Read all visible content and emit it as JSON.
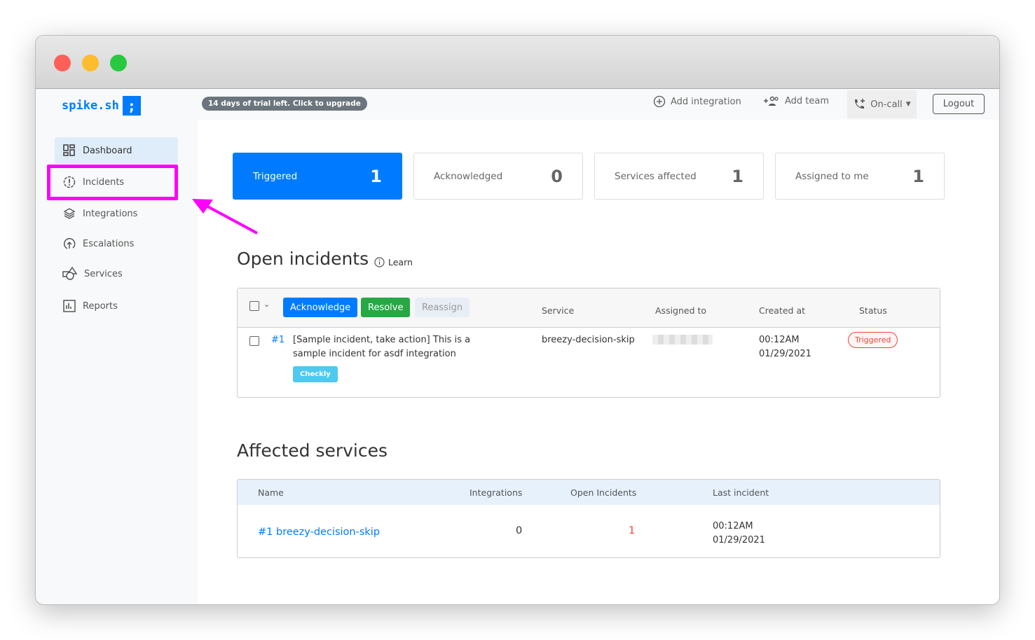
{
  "app": {
    "logo_text": "spike.sh",
    "logo_mark": ";"
  },
  "header": {
    "trial_banner": "14 days of trial left. Click to upgrade",
    "add_integration": "Add integration",
    "add_team": "Add team",
    "on_call": "On-call",
    "logout": "Logout"
  },
  "sidebar": {
    "items": [
      {
        "label": "Dashboard",
        "icon": "dashboard-icon",
        "active": true
      },
      {
        "label": "Incidents",
        "icon": "incident-icon",
        "highlighted": true
      },
      {
        "label": "Integrations",
        "icon": "layers-icon"
      },
      {
        "label": "Escalations",
        "icon": "escalation-icon"
      },
      {
        "label": "Services",
        "icon": "services-icon"
      },
      {
        "label": "Reports",
        "icon": "reports-icon"
      }
    ]
  },
  "stats": [
    {
      "label": "Triggered",
      "value": "1"
    },
    {
      "label": "Acknowledged",
      "value": "0"
    },
    {
      "label": "Services affected",
      "value": "1"
    },
    {
      "label": "Assigned to me",
      "value": "1"
    }
  ],
  "open_incidents": {
    "title": "Open incidents",
    "learn": "Learn",
    "actions": {
      "acknowledge": "Acknowledge",
      "resolve": "Resolve",
      "reassign": "Reassign"
    },
    "columns": {
      "service": "Service",
      "assigned_to": "Assigned to",
      "created_at": "Created at",
      "status": "Status"
    },
    "rows": [
      {
        "id": "#1",
        "title": "[Sample incident, take action] This is a sample incident for asdf integration",
        "tag": "Checkly",
        "service": "breezy-decision-skip",
        "created_time": "00:12AM",
        "created_date": "01/29/2021",
        "status": "Triggered"
      }
    ]
  },
  "affected_services": {
    "title": "Affected services",
    "columns": {
      "name": "Name",
      "integrations": "Integrations",
      "open_incidents": "Open Incidents",
      "last_incident": "Last incident"
    },
    "rows": [
      {
        "name": "#1 breezy-decision-skip",
        "integrations": "0",
        "open_incidents": "1",
        "last_time": "00:12AM",
        "last_date": "01/29/2021"
      }
    ]
  },
  "colors": {
    "primary": "#007bff",
    "success": "#28a745",
    "danger": "#f44336",
    "highlight": "#ff00ff",
    "tag": "#4fc9f0"
  }
}
